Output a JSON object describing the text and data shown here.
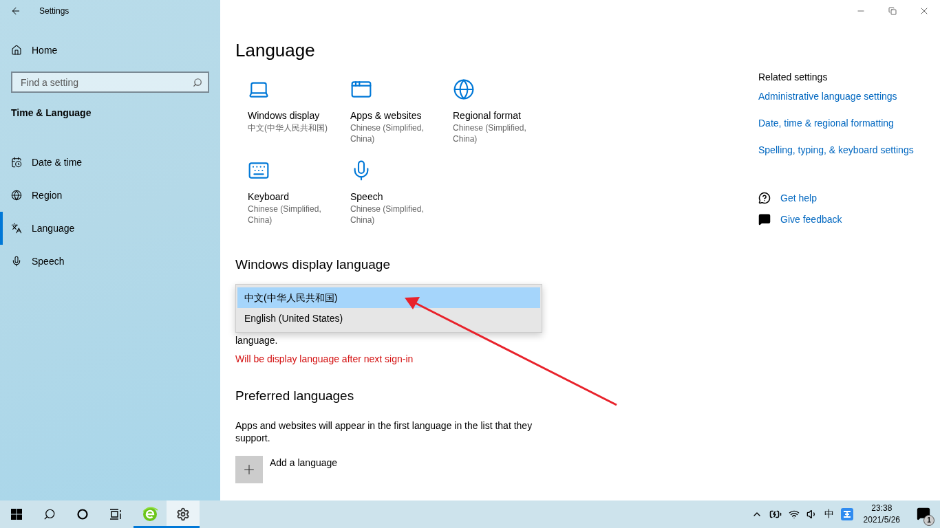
{
  "window": {
    "title": "Settings"
  },
  "sidebar": {
    "home": "Home",
    "search": {
      "placeholder": "Find a setting"
    },
    "section": "Time & Language",
    "items": [
      {
        "label": "Date & time",
        "selected": false
      },
      {
        "label": "Region",
        "selected": false
      },
      {
        "label": "Language",
        "selected": true
      },
      {
        "label": "Speech",
        "selected": false
      }
    ]
  },
  "page": {
    "title": "Language",
    "tiles": [
      {
        "label": "Windows display",
        "value": "中文(中华人民共和国)"
      },
      {
        "label": "Apps & websites",
        "value": "Chinese (Simplified, China)"
      },
      {
        "label": "Regional format",
        "value": "Chinese (Simplified, China)"
      },
      {
        "label": "Keyboard",
        "value": "Chinese (Simplified, China)"
      },
      {
        "label": "Speech",
        "value": "Chinese (Simplified, China)"
      }
    ],
    "display_language": {
      "heading": "Windows display language",
      "options": [
        {
          "label": "中文(中华人民共和国)",
          "selected": true
        },
        {
          "label": "English (United States)",
          "selected": false
        }
      ],
      "partial_text": "language.",
      "notice": "Will be display language after next sign-in"
    },
    "preferred": {
      "heading": "Preferred languages",
      "description": "Apps and websites will appear in the first language in the list that they support.",
      "add_button": "Add a language"
    }
  },
  "related": {
    "heading": "Related settings",
    "links": [
      "Administrative language settings",
      "Date, time & regional formatting",
      "Spelling, typing, & keyboard settings"
    ],
    "help": [
      {
        "kind": "help",
        "label": "Get help"
      },
      {
        "kind": "feedback",
        "label": "Give feedback"
      }
    ]
  },
  "taskbar": {
    "apps": [
      {
        "kind": "start",
        "running": false,
        "selected": false
      },
      {
        "kind": "search",
        "running": false,
        "selected": false
      },
      {
        "kind": "cortana",
        "running": false,
        "selected": false
      },
      {
        "kind": "taskview",
        "running": false,
        "selected": false
      },
      {
        "kind": "browser",
        "running": true,
        "selected": false
      },
      {
        "kind": "settings",
        "running": true,
        "selected": true
      }
    ],
    "tray": {
      "ime": "中",
      "time": "23:38",
      "date": "2021/5/26",
      "notification_count": "1"
    }
  }
}
